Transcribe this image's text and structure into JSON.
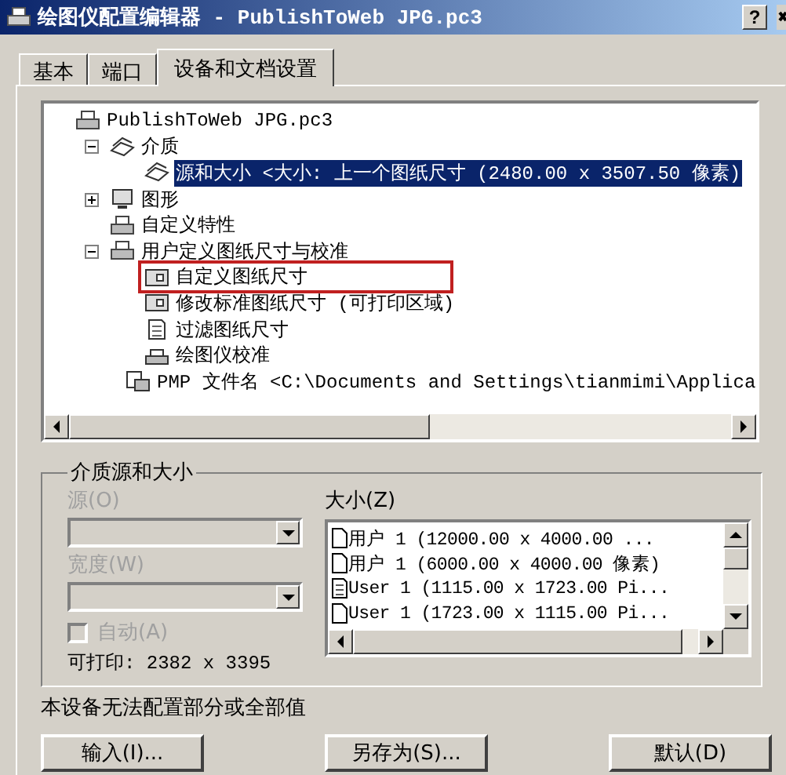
{
  "window": {
    "title": "绘图仪配置编辑器 - PublishToWeb JPG.pc3",
    "help_button": "?"
  },
  "tabs": [
    {
      "label": "基本",
      "selected": false
    },
    {
      "label": "端口",
      "selected": false
    },
    {
      "label": "设备和文档设置",
      "selected": true
    }
  ],
  "tree": [
    {
      "label": "PublishToWeb JPG.pc3",
      "kind": "plotter",
      "selected": false,
      "children": [
        {
          "label": "介质",
          "kind": "media",
          "expanded": true,
          "selected": false,
          "children": [
            {
              "label": "源和大小 <大小: 上一个图纸尺寸  (2480.00 x 3507.50 像素)",
              "kind": "media",
              "selected": true
            }
          ]
        },
        {
          "label": "图形",
          "kind": "graphics",
          "expanded": false,
          "selected": false
        },
        {
          "label": "自定义特性",
          "kind": "properties",
          "selected": false
        },
        {
          "label": "用户定义图纸尺寸与校准",
          "kind": "calibration",
          "expanded": true,
          "selected": false,
          "children": [
            {
              "label": "自定义图纸尺寸",
              "kind": "sheet",
              "selected": false,
              "marked": true
            },
            {
              "label": "修改标准图纸尺寸 (可打印区域)",
              "kind": "sheet",
              "selected": false
            },
            {
              "label": "过滤图纸尺寸",
              "kind": "document",
              "selected": false
            },
            {
              "label": "绘图仪校准",
              "kind": "plotter-small",
              "selected": false
            },
            {
              "label": "PMP 文件名 <C:\\Documents and Settings\\tianmimi\\Applica",
              "kind": "file",
              "selected": false
            }
          ]
        }
      ]
    }
  ],
  "media_group": {
    "title": "介质源和大小",
    "source": {
      "label": "源(O)",
      "disabled": true
    },
    "width": {
      "label": "宽度(W)",
      "disabled": true
    },
    "auto": {
      "label": "自动(A)",
      "checked": false,
      "disabled": true
    },
    "printable": "可打印: 2382 x 3395",
    "size": {
      "label": "大小(Z)",
      "items": [
        {
          "label": "用户 1 (12000.00 x 4000.00 ...",
          "kind": "page"
        },
        {
          "label": "用户 1 (6000.00 x 4000.00 像素)",
          "kind": "page"
        },
        {
          "label": "User 1 (1115.00 x 1723.00 Pi...",
          "kind": "document"
        },
        {
          "label": "User 1 (1723.00 x 1115.00 Pi...",
          "kind": "page"
        }
      ]
    }
  },
  "status": "本设备无法配置部分或全部值",
  "buttons": [
    "输入(I)...",
    "另存为(S)...",
    "默认(D)"
  ]
}
